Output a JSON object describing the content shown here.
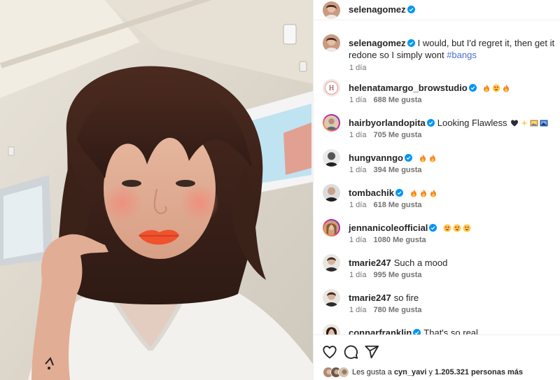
{
  "post": {
    "username": "selenagomez",
    "verified": true
  },
  "caption": {
    "username": "selenagomez",
    "text": "I would, but I'd regret it, then get it redone so I simply wont ",
    "hashtag": "#bangs",
    "time": "1 día"
  },
  "comments": [
    {
      "username": "helenatamargo_browstudio",
      "text": "",
      "emojis": [
        "fire-emoji",
        "heart-eyes-emoji",
        "fire-emoji"
      ],
      "time": "1 día",
      "likes": "688 Me gusta"
    },
    {
      "username": "hairbyorlandopita",
      "text": "Looking Flawless",
      "emojis": [
        "black-heart-emoji",
        "sparkles-emoji",
        "framed-picture-emoji",
        "framed-picture-emoji"
      ],
      "time": "1 día",
      "likes": "705 Me gusta"
    },
    {
      "username": "hungvanngo",
      "text": "",
      "emojis": [
        "fire-emoji",
        "fire-emoji"
      ],
      "time": "1 día",
      "likes": "394 Me gusta"
    },
    {
      "username": "tombachik",
      "text": "",
      "emojis": [
        "fire-emoji",
        "fire-emoji",
        "fire-emoji"
      ],
      "time": "1 día",
      "likes": "618 Me gusta"
    },
    {
      "username": "jennanicoleofficial",
      "text": "",
      "emojis": [
        "heart-eyes-emoji",
        "heart-eyes-emoji",
        "heart-eyes-emoji"
      ],
      "time": "1 día",
      "likes": "1080 Me gusta"
    },
    {
      "username": "tmarie247",
      "text": "Such a mood",
      "emojis": [],
      "time": "1 día",
      "likes": "995 Me gusta"
    },
    {
      "username": "tmarie247",
      "text": "so fire",
      "emojis": [],
      "time": "1 día",
      "likes": "780 Me gusta"
    },
    {
      "username": "connarfranklin",
      "text": "That's so real",
      "emojis": [],
      "time": "",
      "likes": ""
    }
  ],
  "actions": {
    "like_icon": "heart-icon",
    "comment_icon": "comment-icon",
    "share_icon": "share-icon"
  },
  "likes_summary": {
    "prefix": "Les gusta a ",
    "user": "cyn_yavi",
    "middle": " y ",
    "count": "1.205.321 personas más"
  },
  "colors": {
    "verified": "#0095f6",
    "meta_text": "#737373",
    "hashtag": "#4a6fd1",
    "lips": "#f0522e"
  }
}
